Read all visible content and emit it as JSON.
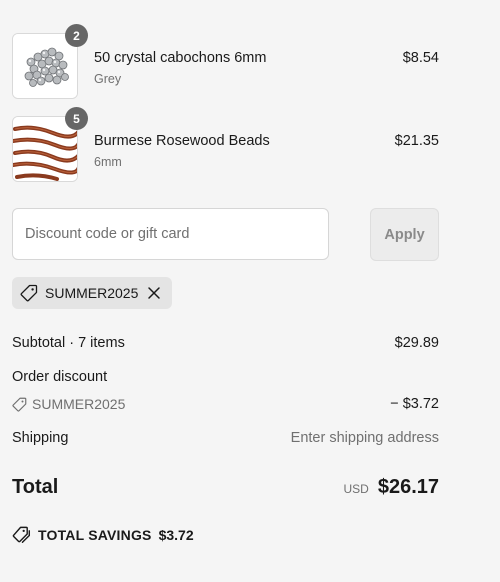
{
  "line_items": [
    {
      "quantity": "2",
      "title": "50 crystal cabochons 6mm",
      "variant": "Grey",
      "price": "$8.54",
      "image_icon": "crystal-cabochons-thumbnail"
    },
    {
      "quantity": "5",
      "title": "Burmese Rosewood Beads",
      "variant": "6mm",
      "price": "$21.35",
      "image_icon": "rosewood-beads-thumbnail"
    }
  ],
  "discount": {
    "placeholder": "Discount code or gift card",
    "apply_label": "Apply",
    "applied_code": "SUMMER2025",
    "tag_icon": "tag-icon",
    "remove_icon": "close-icon"
  },
  "summary": {
    "subtotal_label": "Subtotal · 7 items",
    "subtotal_value": "$29.89",
    "order_discount_label": "Order discount",
    "order_discount_code": "SUMMER2025",
    "order_discount_value": "− $3.72",
    "shipping_label": "Shipping",
    "shipping_value": "Enter shipping address",
    "total_label": "Total",
    "currency": "USD",
    "total_value": "$26.17",
    "savings_label": "TOTAL SAVINGS",
    "savings_value": "$3.72",
    "savings_icon": "tags-icon"
  },
  "colors": {
    "background": "#f5f5f5",
    "badge": "#666666",
    "chip": "#e4e4e4",
    "muted_text": "#707070"
  }
}
